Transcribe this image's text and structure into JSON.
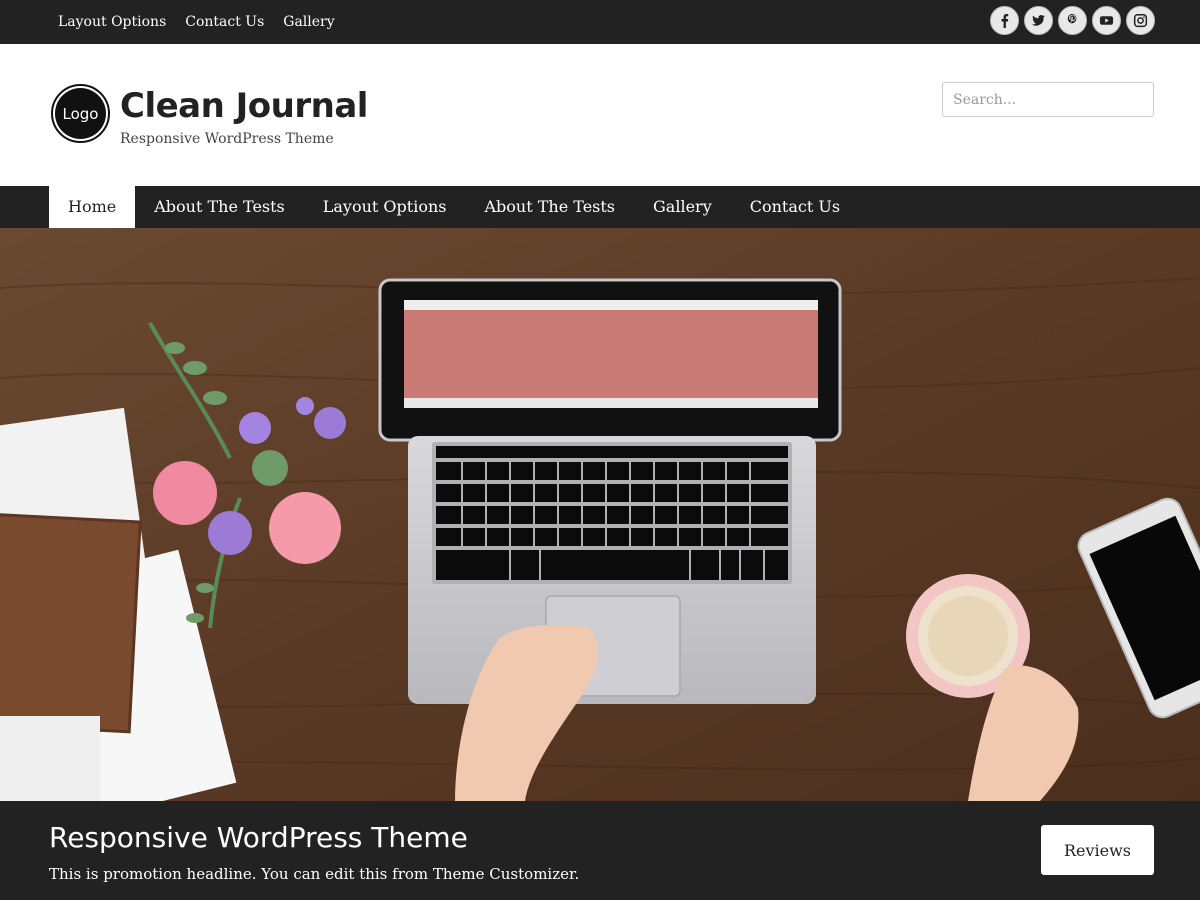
{
  "topbar": {
    "nav": [
      "Layout Options",
      "Contact Us",
      "Gallery"
    ],
    "social": [
      "facebook-icon",
      "twitter-icon",
      "pinterest-icon",
      "youtube-icon",
      "instagram-icon"
    ]
  },
  "header": {
    "logo_text": "Logo",
    "title": "Clean Journal",
    "tagline": "Responsive WordPress Theme",
    "search_placeholder": "Search..."
  },
  "mainnav": {
    "items": [
      "Home",
      "About The Tests",
      "Layout Options",
      "About The Tests",
      "Gallery",
      "Contact Us"
    ],
    "active": "Home"
  },
  "hero": {
    "image": "desk-laptop-photo"
  },
  "promo": {
    "title": "Responsive WordPress Theme",
    "text": "This is promotion headline. You can edit this from Theme Customizer.",
    "button": "Reviews"
  },
  "colors": {
    "dark": "#222222",
    "white": "#ffffff"
  }
}
